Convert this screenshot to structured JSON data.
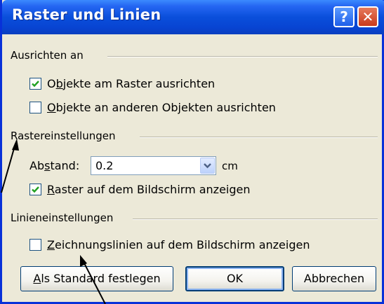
{
  "window": {
    "title": "Raster und Linien",
    "help_glyph": "?",
    "close_glyph": "✕"
  },
  "sections": {
    "align": {
      "label": "Ausrichten an",
      "options": [
        {
          "pre": "O",
          "mnemonic": "b",
          "post": "jekte am Raster ausrichten",
          "checked": true
        },
        {
          "pre": "",
          "mnemonic": "O",
          "post": "bjekte an anderen Objekten ausrichten",
          "checked": false
        }
      ]
    },
    "grid": {
      "label": "Rastereinstellungen",
      "spacing_label_pre": "Ab",
      "spacing_label_mnemonic": "s",
      "spacing_label_post": "tand:",
      "spacing_value": "0.2",
      "spacing_unit": "cm",
      "show_grid": {
        "pre": "",
        "mnemonic": "R",
        "post": "aster auf dem Bildschirm anzeigen",
        "checked": true
      }
    },
    "lines": {
      "label": "Linieneinstellungen",
      "show_lines": {
        "pre": "",
        "mnemonic": "Z",
        "post": "eichnungslinien auf dem Bildschirm anzeigen",
        "checked": false
      }
    }
  },
  "buttons": {
    "set_default": {
      "pre": "",
      "mnemonic": "A",
      "post": "ls Standard festlegen"
    },
    "ok": "OK",
    "cancel": "Abbrechen"
  },
  "colors": {
    "titlebar": "#0a4fdb",
    "dialog_bg": "#ece9d8",
    "check": "#21a121",
    "close": "#c9391b"
  }
}
